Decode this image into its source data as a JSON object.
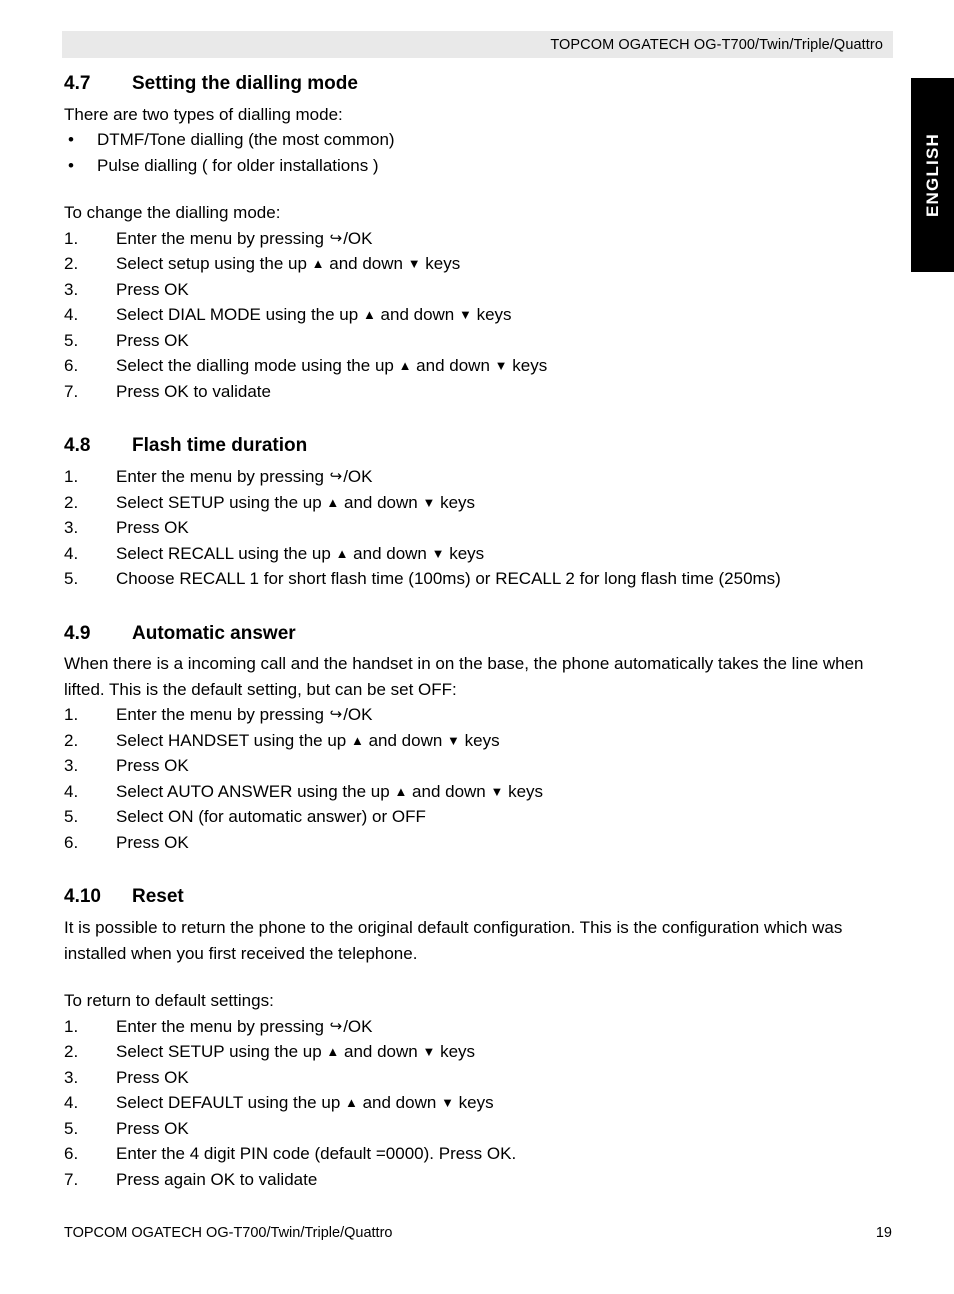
{
  "header": {
    "title": "TOPCOM OGATECH OG-T700/Twin/Triple/Quattro"
  },
  "language_tab": {
    "label": "ENGLISH"
  },
  "glyphs": {
    "menu_key": "↪",
    "up_key": "▲",
    "down_key": "▼",
    "bullet": "•"
  },
  "sections": [
    {
      "number": "4.7",
      "title": "Setting the dialling mode",
      "intro": "There are two types of dialling mode:",
      "bullets": [
        "DTMF/Tone dialling (the most common)",
        "Pulse dialling ( for older installations )"
      ],
      "lead_in": "To change the dialling mode:",
      "steps": [
        {
          "num": "1.",
          "pre": "Enter the menu by pressing ",
          "glyph": "menu",
          "post": "/OK"
        },
        {
          "num": "2.",
          "pre": "Select setup using the up ",
          "glyph": "updown",
          "mid": " and down ",
          "post": " keys"
        },
        {
          "num": "3.",
          "pre": "Press OK"
        },
        {
          "num": "4.",
          "pre": "Select DIAL MODE using the up ",
          "glyph": "updown",
          "mid": " and down ",
          "post": " keys"
        },
        {
          "num": "5.",
          "pre": "Press OK"
        },
        {
          "num": "6.",
          "pre": "Select the dialling mode using the up ",
          "glyph": "updown",
          "mid": " and down ",
          "post": " keys"
        },
        {
          "num": "7.",
          "pre": "Press OK to validate"
        }
      ]
    },
    {
      "number": "4.8",
      "title": "Flash time duration",
      "steps": [
        {
          "num": "1.",
          "pre": "Enter the menu by pressing ",
          "glyph": "menu",
          "post": "/OK"
        },
        {
          "num": "2.",
          "pre": "Select SETUP using the up ",
          "glyph": "updown",
          "mid": " and down ",
          "post": " keys"
        },
        {
          "num": "3.",
          "pre": "Press OK"
        },
        {
          "num": "4.",
          "pre": "Select RECALL using the up ",
          "glyph": "updown",
          "mid": " and down ",
          "post": " keys"
        },
        {
          "num": "5.",
          "pre": "Choose RECALL 1 for short flash time (100ms) or RECALL 2 for long flash time (250ms)"
        }
      ]
    },
    {
      "number": "4.9",
      "title": "Automatic answer",
      "intro": "When there is a incoming call and the handset in on the base, the phone automatically takes the line when lifted. This is the default setting, but can be set OFF:",
      "steps": [
        {
          "num": "1.",
          "pre": "Enter the menu by pressing ",
          "glyph": "menu",
          "post": "/OK"
        },
        {
          "num": "2.",
          "pre": "Select HANDSET using the up ",
          "glyph": "updown",
          "mid": " and down ",
          "post": " keys"
        },
        {
          "num": "3.",
          "pre": "Press OK"
        },
        {
          "num": "4.",
          "pre": "Select AUTO ANSWER using the up ",
          "glyph": "updown",
          "mid": " and down ",
          "post": " keys"
        },
        {
          "num": "5.",
          "pre": "Select ON (for automatic answer) or OFF"
        },
        {
          "num": "6.",
          "pre": "Press OK"
        }
      ]
    },
    {
      "number": "4.10",
      "title": "Reset",
      "intro": "It is possible to return the phone to the original default configuration. This is the configuration which was installed when you first received the telephone.",
      "lead_in": "To return to default settings:",
      "steps": [
        {
          "num": "1.",
          "pre": "Enter the menu by pressing ",
          "glyph": "menu",
          "post": "/OK"
        },
        {
          "num": "2.",
          "pre": "Select SETUP using the up ",
          "glyph": "updown",
          "mid": " and down ",
          "post": " keys"
        },
        {
          "num": "3.",
          "pre": "Press OK"
        },
        {
          "num": "4.",
          "pre": "Select DEFAULT using the up ",
          "glyph": "updown",
          "mid": " and down ",
          "post": " keys"
        },
        {
          "num": "5.",
          "pre": "Press OK"
        },
        {
          "num": "6.",
          "pre": "Enter the 4 digit PIN code (default =0000). Press OK."
        },
        {
          "num": "7.",
          "pre": "Press again OK to validate"
        }
      ]
    }
  ],
  "footer": {
    "left": "TOPCOM OGATECH OG-T700/Twin/Triple/Quattro",
    "page_number": "19"
  }
}
